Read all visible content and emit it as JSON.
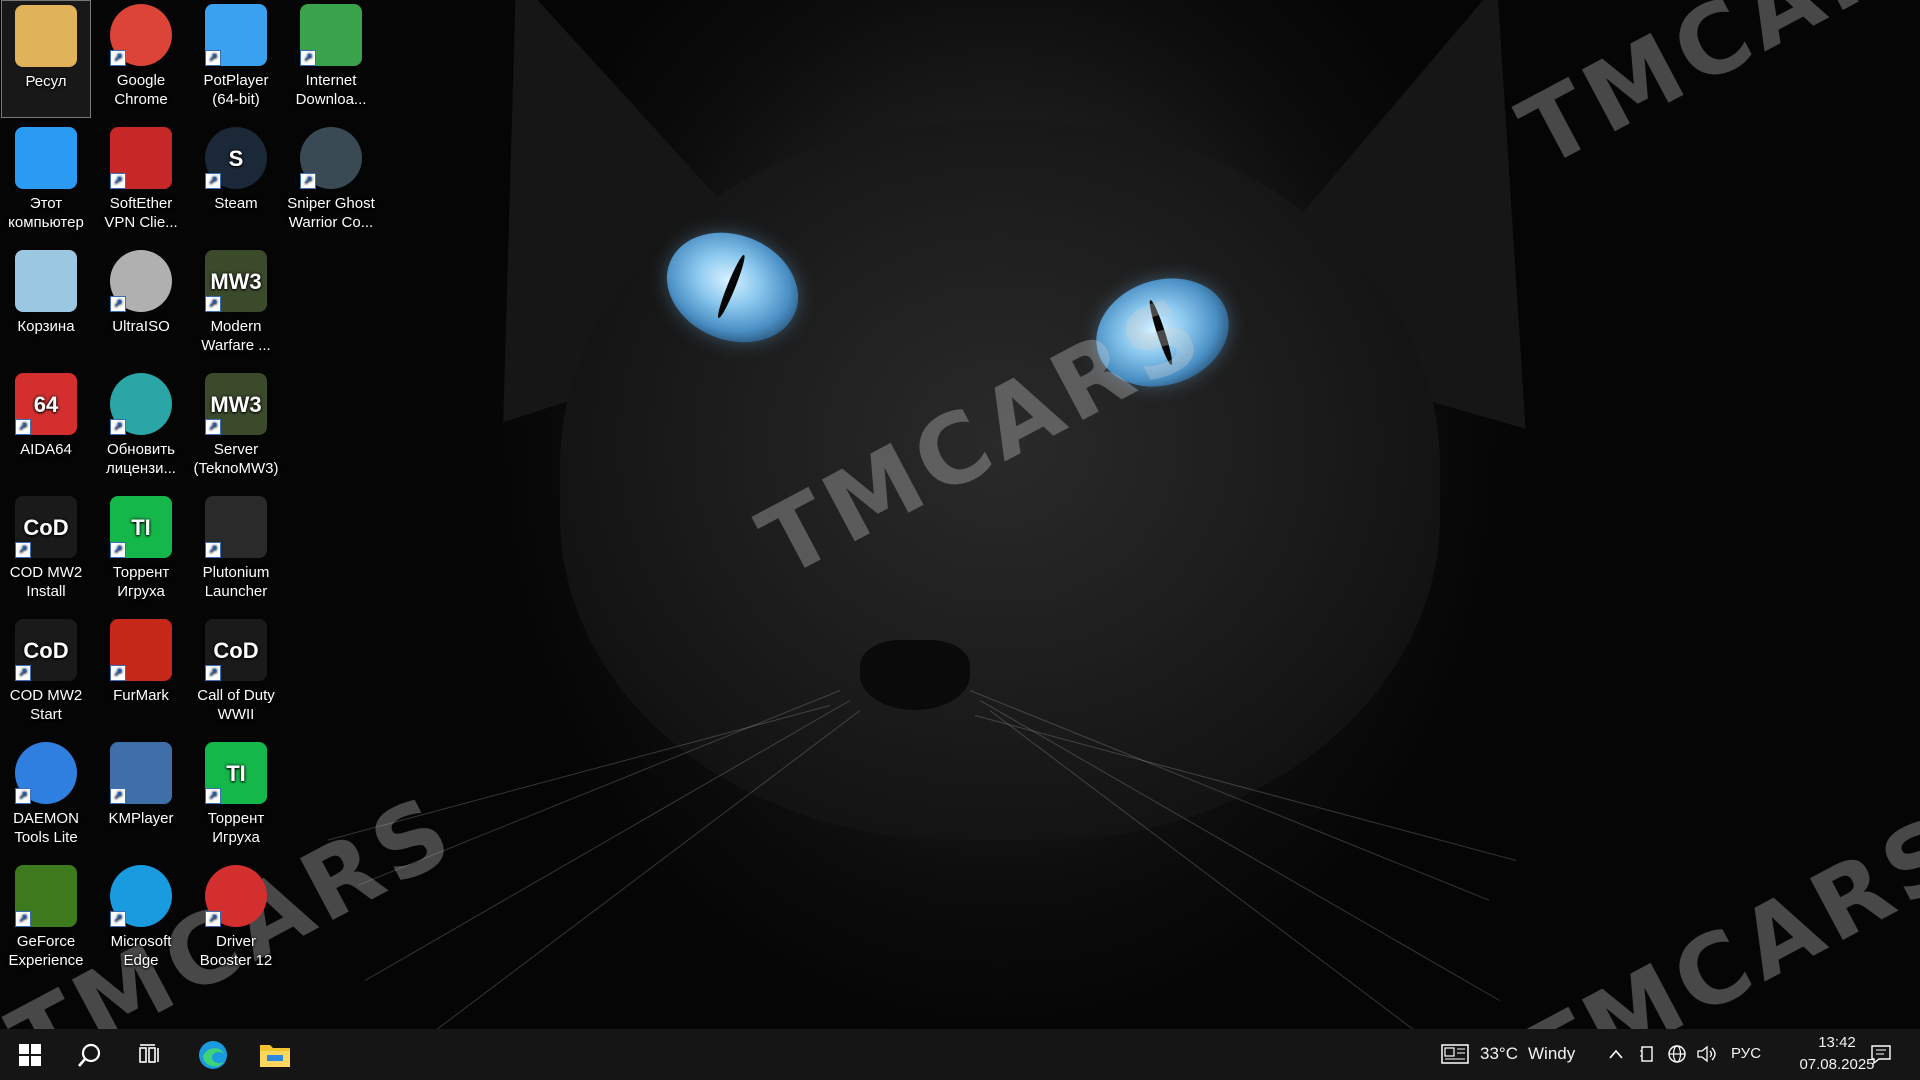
{
  "desktop": {
    "watermark": "TMCARS",
    "icons": [
      {
        "label": "Ресул",
        "icon": "user-folder-icon",
        "color": "#e0b35a"
      },
      {
        "label": "Google Chrome",
        "icon": "chrome-icon",
        "color": "#db4437"
      },
      {
        "label": "PotPlayer (64-bit)",
        "icon": "potplayer-icon",
        "color": "#3aa0f0"
      },
      {
        "label": "Internet Downloa...",
        "icon": "internet-download-manager-icon",
        "color": "#3aa24a"
      },
      {
        "label": "Этот компьютер",
        "icon": "this-pc-icon",
        "color": "#2b9af3"
      },
      {
        "label": "SoftEther VPN Clie...",
        "icon": "softether-vpn-icon",
        "color": "#c62828"
      },
      {
        "label": "Steam",
        "icon": "steam-icon",
        "color": "#1b2838"
      },
      {
        "label": "Sniper Ghost Warrior Co...",
        "icon": "sniper-ghost-warrior-icon",
        "color": "#3a4a55"
      },
      {
        "label": "Корзина",
        "icon": "recycle-bin-icon",
        "color": "#9cc7e3"
      },
      {
        "label": "UltraISO",
        "icon": "ultraiso-icon",
        "color": "#b0b0b0"
      },
      {
        "label": "Modern Warfare ...",
        "icon": "modern-warfare-icon",
        "color": "#3c4a2c"
      },
      {
        "label": "AIDA64",
        "icon": "aida64-icon",
        "color": "#d32f2f"
      },
      {
        "label": "Обновить лицензи...",
        "icon": "update-license-icon",
        "color": "#2aa6a6"
      },
      {
        "label": "Server (TeknoMW3)",
        "icon": "server-teknomw3-icon",
        "color": "#3c4a2c"
      },
      {
        "label": "COD MW2 Install",
        "icon": "cod-mw2-install-icon",
        "color": "#1a1a1a"
      },
      {
        "label": "Торрент Игруха",
        "icon": "torrent-igruha-icon",
        "color": "#14b84a"
      },
      {
        "label": "Plutonium Launcher",
        "icon": "plutonium-launcher-icon",
        "color": "#2a2a2a"
      },
      {
        "label": "COD MW2 Start",
        "icon": "cod-mw2-start-icon",
        "color": "#1a1a1a"
      },
      {
        "label": "FurMark",
        "icon": "furmark-icon",
        "color": "#c6281a"
      },
      {
        "label": "Call of Duty WWII",
        "icon": "call-of-duty-wwii-icon",
        "color": "#1a1a1a"
      },
      {
        "label": "DAEMON Tools Lite",
        "icon": "daemon-tools-icon",
        "color": "#2f7fe0"
      },
      {
        "label": "KMPlayer",
        "icon": "kmplayer-icon",
        "color": "#3f6fa8"
      },
      {
        "label": "Торрент Игруха",
        "icon": "torrent-igruha-icon",
        "color": "#14b84a"
      },
      {
        "label": "GeForce Experience",
        "icon": "geforce-experience-icon",
        "color": "#3d7a1e"
      },
      {
        "label": "Microsoft Edge",
        "icon": "edge-icon",
        "color": "#1a9be0"
      },
      {
        "label": "Driver Booster 12",
        "icon": "driver-booster-icon",
        "color": "#d32f2f"
      }
    ],
    "glyphs": {
      "aida": "64",
      "torrent": "TI",
      "cod": "CoD",
      "steam": "S",
      "mw": "MW3"
    }
  },
  "taskbar": {
    "start_icon": "windows-start-icon",
    "search_icon": "search-icon",
    "task_view_icon": "task-view-icon",
    "edge_icon": "edge-icon",
    "explorer_icon": "file-explorer-icon",
    "weather_temp": "33°C",
    "weather_condition": "Windy",
    "language": "РУС",
    "time": "13:42",
    "date": "07.08.2025"
  }
}
